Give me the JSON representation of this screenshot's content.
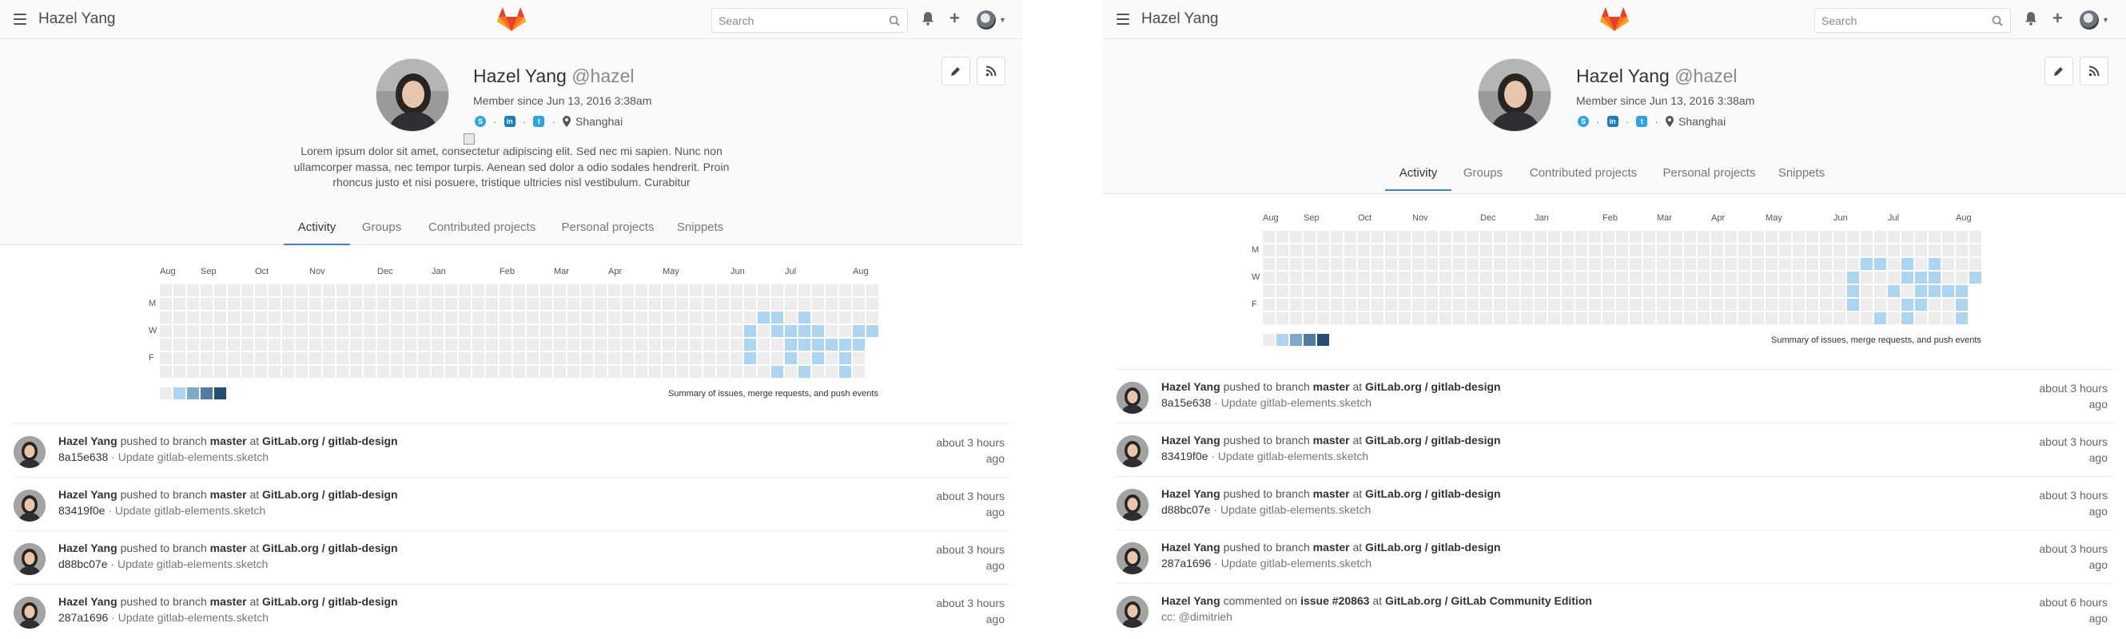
{
  "left": {
    "header": {
      "site_title": "Hazel Yang",
      "search_placeholder": "Search"
    },
    "profile": {
      "name": "Hazel Yang",
      "username": "@hazel",
      "member_since": "Member since Jun 13, 2016 3:38am",
      "location": "Shanghai",
      "bio": "Lorem ipsum dolor sit amet, consectetur adipiscing elit. Sed nec mi sapien. Nunc non ullamcorper massa, nec tempor turpis. Aenean sed dolor a odio sodales hendrerit. Proin rhoncus justo et nisi posuere, tristique ultricies nisl vestibulum. Curabitur"
    },
    "tabs": [
      "Activity",
      "Groups",
      "Contributed projects",
      "Personal projects",
      "Snippets"
    ],
    "active_tab": "Activity",
    "contributions": {
      "months": [
        "Aug",
        "Sep",
        "Oct",
        "Nov",
        "Dec",
        "Jan",
        "Feb",
        "Mar",
        "Apr",
        "May",
        "Jun",
        "Jul",
        "Aug"
      ],
      "day_labels": [
        "M",
        "W",
        "F"
      ],
      "summary": "Summary of issues, merge requests, and push events",
      "legend_colors": [
        "#ededed",
        "#acd5f2",
        "#7fa8c9",
        "#527ba0",
        "#254e77"
      ]
    },
    "events": [
      {
        "author": "Hazel Yang",
        "action": "pushed to branch",
        "target": "master",
        "at": "at",
        "project": "GitLab.org / gitlab-design",
        "sha": "8a15e638",
        "message": "Update gitlab-elements.sketch",
        "time_line1": "about 3 hours",
        "time_line2": "ago"
      },
      {
        "author": "Hazel Yang",
        "action": "pushed to branch",
        "target": "master",
        "at": "at",
        "project": "GitLab.org / gitlab-design",
        "sha": "83419f0e",
        "message": "Update gitlab-elements.sketch",
        "time_line1": "about 3 hours",
        "time_line2": "ago"
      },
      {
        "author": "Hazel Yang",
        "action": "pushed to branch",
        "target": "master",
        "at": "at",
        "project": "GitLab.org / gitlab-design",
        "sha": "d88bc07e",
        "message": "Update gitlab-elements.sketch",
        "time_line1": "about 3 hours",
        "time_line2": "ago"
      },
      {
        "author": "Hazel Yang",
        "action": "pushed to branch",
        "target": "master",
        "at": "at",
        "project": "GitLab.org / gitlab-design",
        "sha": "287a1696",
        "message": "Update gitlab-elements.sketch",
        "time_line1": "about 3 hours",
        "time_line2": "ago"
      }
    ]
  },
  "right": {
    "header": {
      "site_title": "Hazel Yang",
      "search_placeholder": "Search"
    },
    "profile": {
      "name": "Hazel Yang",
      "username": "@hazel",
      "member_since": "Member since Jun 13, 2016 3:38am",
      "location": "Shanghai"
    },
    "tabs": [
      "Activity",
      "Groups",
      "Contributed projects",
      "Personal projects",
      "Snippets"
    ],
    "active_tab": "Activity",
    "contributions": {
      "months": [
        "Aug",
        "Sep",
        "Oct",
        "Nov",
        "Dec",
        "Jan",
        "Feb",
        "Mar",
        "Apr",
        "May",
        "Jun",
        "Jul",
        "Aug"
      ],
      "day_labels": [
        "M",
        "W",
        "F"
      ],
      "summary": "Summary of issues, merge requests, and push events",
      "legend_colors": [
        "#ededed",
        "#acd5f2",
        "#7fa8c9",
        "#527ba0",
        "#254e77"
      ]
    },
    "events": [
      {
        "author": "Hazel Yang",
        "action": "pushed to branch",
        "target": "master",
        "at": "at",
        "project": "GitLab.org / gitlab-design",
        "sha": "8a15e638",
        "message": "Update gitlab-elements.sketch",
        "time_line1": "about 3 hours",
        "time_line2": "ago"
      },
      {
        "author": "Hazel Yang",
        "action": "pushed to branch",
        "target": "master",
        "at": "at",
        "project": "GitLab.org / gitlab-design",
        "sha": "83419f0e",
        "message": "Update gitlab-elements.sketch",
        "time_line1": "about 3 hours",
        "time_line2": "ago"
      },
      {
        "author": "Hazel Yang",
        "action": "pushed to branch",
        "target": "master",
        "at": "at",
        "project": "GitLab.org / gitlab-design",
        "sha": "d88bc07e",
        "message": "Update gitlab-elements.sketch",
        "time_line1": "about 3 hours",
        "time_line2": "ago"
      },
      {
        "author": "Hazel Yang",
        "action": "pushed to branch",
        "target": "master",
        "at": "at",
        "project": "GitLab.org / gitlab-design",
        "sha": "287a1696",
        "message": "Update gitlab-elements.sketch",
        "time_line1": "about 3 hours",
        "time_line2": "ago"
      },
      {
        "author": "Hazel Yang",
        "action": "commented on",
        "target": "issue #20863",
        "at": "at",
        "project": "GitLab.org / GitLab Community Edition",
        "sha": "",
        "message": "cc: @dimitrieh",
        "time_line1": "about 6 hours",
        "time_line2": "ago"
      }
    ]
  },
  "icons": [
    "hamburger-icon",
    "gitlab-logo",
    "search-icon",
    "bell-icon",
    "plus-icon",
    "avatar",
    "pencil-icon",
    "rss-icon",
    "skype-icon",
    "linkedin-icon",
    "twitter-icon",
    "location-pin-icon"
  ]
}
